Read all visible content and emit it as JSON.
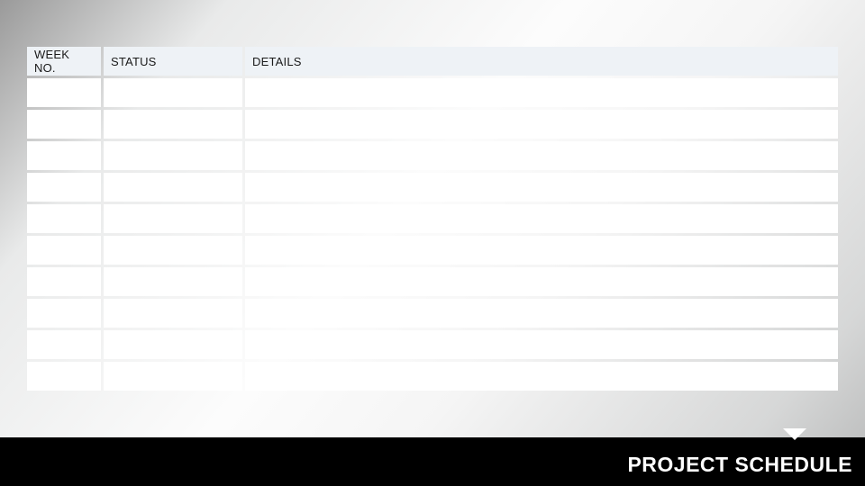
{
  "footer": {
    "title": "PROJECT SCHEDULE"
  },
  "table": {
    "headers": {
      "week": "WEEK NO.",
      "status": "STATUS",
      "details": "DETAILS"
    },
    "rows": [
      {
        "week": "",
        "status": "",
        "details": ""
      },
      {
        "week": "",
        "status": "",
        "details": ""
      },
      {
        "week": "",
        "status": "",
        "details": ""
      },
      {
        "week": "",
        "status": "",
        "details": ""
      },
      {
        "week": "",
        "status": "",
        "details": ""
      },
      {
        "week": "",
        "status": "",
        "details": ""
      },
      {
        "week": "",
        "status": "",
        "details": ""
      },
      {
        "week": "",
        "status": "",
        "details": ""
      },
      {
        "week": "",
        "status": "",
        "details": ""
      },
      {
        "week": "",
        "status": "",
        "details": ""
      }
    ]
  }
}
